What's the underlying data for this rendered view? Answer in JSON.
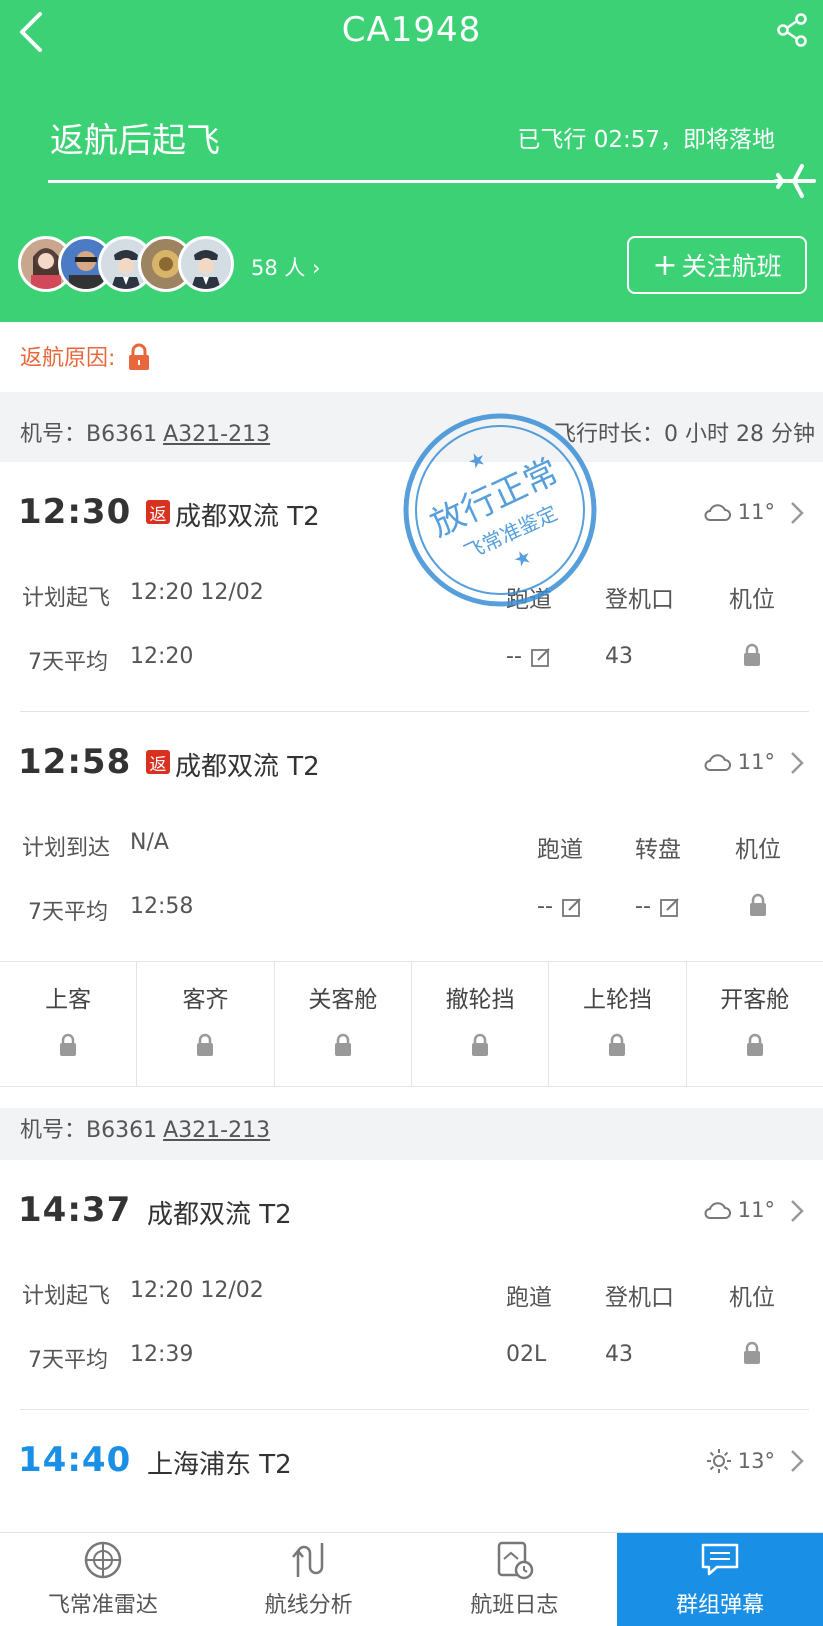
{
  "header": {
    "flight_no": "CA1948",
    "status_main": "返航后起飞",
    "status_sub": "已飞行 02:57，即将落地",
    "followers": "58 人",
    "follow_button": "关注航班",
    "bg_color": "#3dd176"
  },
  "reason": {
    "label": "返航原因:"
  },
  "plane_row_1": {
    "reg": "机号：B6361",
    "model": "A321-213",
    "duration": "飞行时长：0 小时 28 分钟"
  },
  "plane_row_2": {
    "reg": "机号：B6361",
    "model": "A321-213"
  },
  "leg1": {
    "time": "12:30",
    "badge": "返",
    "airport": "成都双流 T2",
    "temp": "11°",
    "sched_label": "计划起飞",
    "sched_value": "12:20 12/02",
    "avg_label": "7天平均",
    "avg_value": "12:20",
    "col1_head": "跑道",
    "col2_head": "登机口",
    "col3_head": "机位",
    "col1_val": "--",
    "col2_val": "43"
  },
  "leg2": {
    "time": "12:58",
    "badge": "返",
    "airport": "成都双流 T2",
    "temp": "11°",
    "sched_label": "计划到达",
    "sched_value": "N/A",
    "avg_label": "7天平均",
    "avg_value": "12:58",
    "col1_head": "跑道",
    "col2_head": "转盘",
    "col3_head": "机位",
    "col1_val": "--",
    "col2_val": "--"
  },
  "milestones": [
    "上客",
    "客齐",
    "关客舱",
    "撤轮挡",
    "上轮挡",
    "开客舱"
  ],
  "leg3": {
    "time": "14:37",
    "airport": "成都双流 T2",
    "temp": "11°",
    "sched_label": "计划起飞",
    "sched_value": "12:20 12/02",
    "avg_label": "7天平均",
    "avg_value": "12:39",
    "col1_head": "跑道",
    "col2_head": "登机口",
    "col3_head": "机位",
    "col1_val": "02L",
    "col2_val": "43"
  },
  "leg4": {
    "time": "14:40",
    "airport": "上海浦东 T2",
    "temp": "13°"
  },
  "stamp": {
    "line1": "放行正常",
    "line2": "飞常准鉴定"
  },
  "tabs": [
    {
      "label": "飞常准雷达",
      "icon": "radar-icon"
    },
    {
      "label": "航线分析",
      "icon": "route-icon"
    },
    {
      "label": "航班日志",
      "icon": "log-icon"
    },
    {
      "label": "群组弹幕",
      "icon": "chat-icon"
    }
  ],
  "colors": {
    "accent": "#1a8fe6",
    "return_badge": "#d9311f",
    "reason_text": "#e8673c"
  }
}
